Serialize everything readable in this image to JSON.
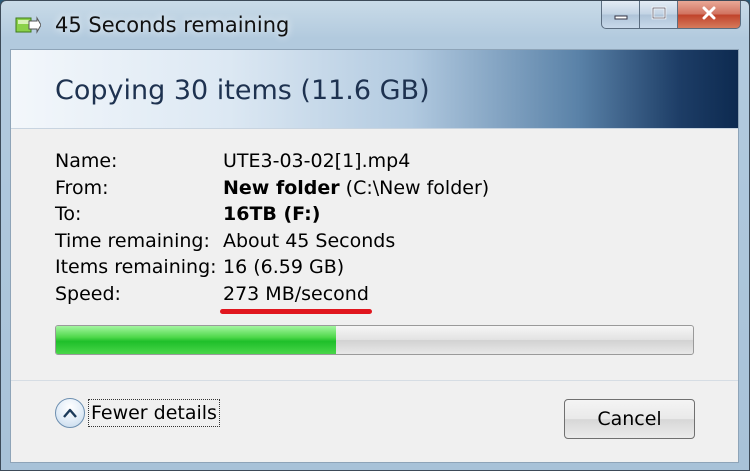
{
  "window": {
    "title": "45 Seconds remaining",
    "icon": "file-copy-icon",
    "caption_buttons": [
      "minimize-icon",
      "maximize-icon",
      "close-icon"
    ]
  },
  "header": {
    "title": "Copying 30 items (11.6 GB)"
  },
  "details": {
    "name_label": "Name:",
    "name_value": "UTE3-03-02[1].mp4",
    "from_label": "From:",
    "from_value": "New folder",
    "from_path": "(C:\\New folder)",
    "to_label": "To:",
    "to_value": "16TB (F:)",
    "time_label": "Time remaining:",
    "time_value": "About 45 Seconds",
    "items_label": "Items remaining:",
    "items_value": "16 (6.59 GB)",
    "speed_label": "Speed:",
    "speed_value": "273 MB/second"
  },
  "progress": {
    "fraction": 0.44
  },
  "footer": {
    "details_toggle_label": "Fewer details",
    "cancel_label": "Cancel"
  },
  "colors": {
    "progress_green": "#1fbf2a",
    "annotation_red": "#e0161e",
    "banner_dark": "#0d2a50"
  }
}
